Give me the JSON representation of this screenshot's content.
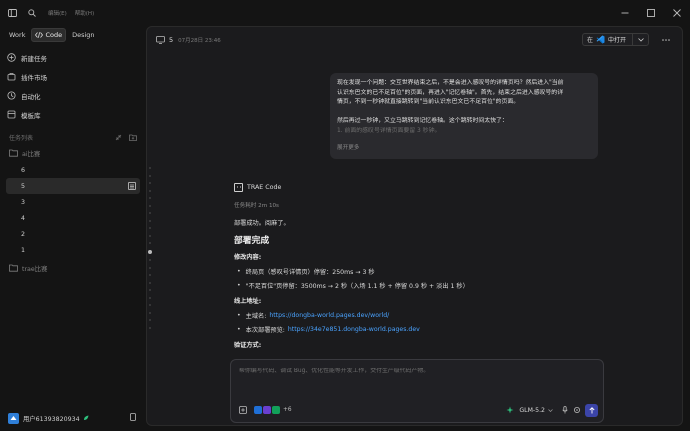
{
  "titlebar": {
    "menu_label": "编辑(E)",
    "help_label": "帮助(H)"
  },
  "sidebar": {
    "mode_tabs": [
      "Work",
      "Code",
      "Design"
    ],
    "active_mode": "Code",
    "nav": [
      {
        "label": "新建任务",
        "icon": "new-task-icon"
      },
      {
        "label": "插件市场",
        "icon": "plugin-market-icon"
      },
      {
        "label": "自动化",
        "icon": "automation-icon"
      },
      {
        "label": "模板库",
        "icon": "template-library-icon"
      }
    ],
    "task_list_title": "任务列表",
    "groups": [
      {
        "label": "ai比赛",
        "expanded": true
      },
      {
        "label": "trae比赛",
        "expanded": false
      }
    ],
    "tasks": [
      "6",
      "5",
      "3",
      "4",
      "2",
      "1"
    ],
    "active_task": "5",
    "user": {
      "name": "用户61393820934"
    }
  },
  "main": {
    "task_number": "5",
    "timestamp": "07月28日 23:46",
    "open_in_label": "在",
    "open_in_suffix": "中打开",
    "user_message": {
      "lines": [
        "现在发现一个问题：交互世界结束之后，不是会进入感叹号的详情页吗？然后进入\"当前",
        "认识东巴文的已不足百位\"的页面，再进入\"记忆卷轴\"。首先，结束之后进入感叹号的详",
        "情页，不到一秒钟就直接跳转到\"当前认识东巴文已不足百位\"的页面。"
      ],
      "lines2": [
        "然后再过一秒钟，又立马跳转到记忆卷轴。这个跳转时间太快了：",
        "1. 前面的感叹号详情页面要留 3 秒钟。"
      ],
      "expand_label": "展开更多"
    },
    "agent": {
      "name": "TRAE Code",
      "elapsed": "任务耗时 2m 10s",
      "line1": "部署成功。阅麻了。",
      "heading": "部署完成",
      "changes_title": "修改内容:",
      "changes": [
        "终局页（感叹号详情页）停留：250ms → 3 秒",
        "\"不足百位\"页停留：3500ms → 2 秒（入场 1.1 秒 + 停留 0.9 秒 + 淡出 1 秒）"
      ],
      "online_title": "线上地址:",
      "main_domain_label": "主域名:",
      "main_domain_url": "https://dongba-world.pages.dev/world/",
      "preview_label": "本次部署预览:",
      "preview_url": "https://34e7e851.dongba-world.pages.dev",
      "verify_title": "验证方式:"
    },
    "composer": {
      "placeholder": "帮你编写代码、调试 Bug、优化性能等开发工作，交付生产级代码产物。",
      "context_more": "+6",
      "model": "GLM-5.2"
    }
  },
  "colors": {
    "accent": "#3b44a8",
    "link": "#4aa3ff",
    "avatar": "#2f7fd8",
    "vscode_blue": "#1e8ae6"
  }
}
